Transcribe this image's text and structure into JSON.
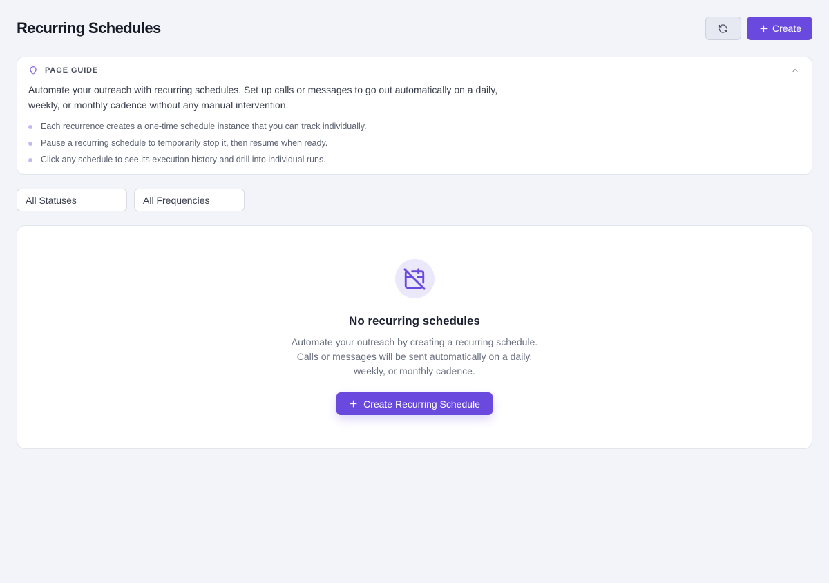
{
  "page": {
    "title": "Recurring Schedules"
  },
  "header": {
    "refresh_icon": "refresh-icon",
    "create_label": "Create",
    "create_icon": "plus-icon"
  },
  "guide": {
    "icon": "lightbulb-icon",
    "title": "PAGE GUIDE",
    "collapse_icon": "chevron-up-icon",
    "description": "Automate your outreach with recurring schedules. Set up calls or messages to go out automatically on a daily, weekly, or monthly cadence without any manual intervention.",
    "bullets": [
      "Each recurrence creates a one-time schedule instance that you can track individually.",
      "Pause a recurring schedule to temporarily stop it, then resume when ready.",
      "Click any schedule to see its execution history and drill into individual runs."
    ]
  },
  "filters": {
    "status": "All Statuses",
    "frequency": "All Frequencies"
  },
  "empty_state": {
    "icon": "calendar-off-icon",
    "title": "No recurring schedules",
    "description": "Automate your outreach by creating a recurring schedule. Calls or messages will be sent automatically on a daily, weekly, or monthly cadence.",
    "cta_label": "Create Recurring Schedule"
  },
  "colors": {
    "accent": "#6a4ade",
    "background": "#f3f4f9",
    "card": "#ffffff"
  }
}
